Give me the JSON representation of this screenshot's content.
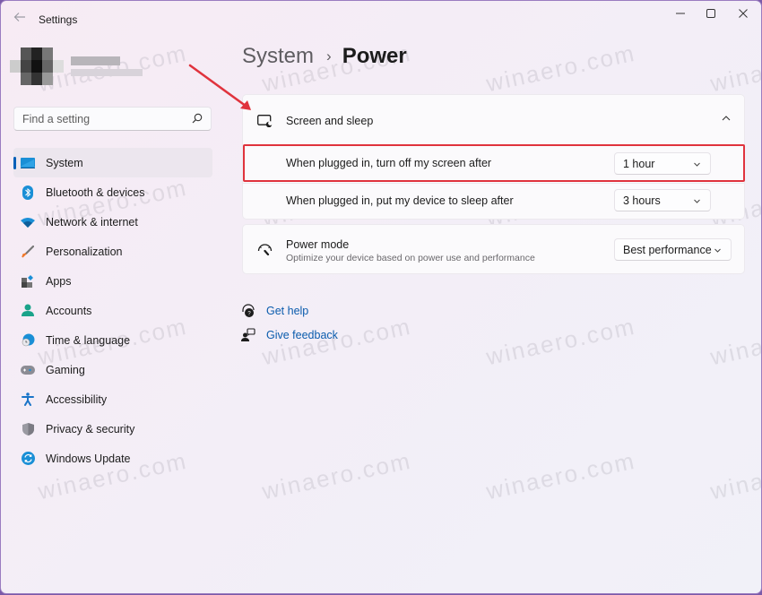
{
  "window": {
    "title": "Settings",
    "controls": [
      "minimize",
      "maximize",
      "close"
    ]
  },
  "search": {
    "placeholder": "Find a setting"
  },
  "sidebar": {
    "items": [
      {
        "label": "System",
        "icon": "monitor-icon",
        "active": true
      },
      {
        "label": "Bluetooth & devices",
        "icon": "bluetooth-icon"
      },
      {
        "label": "Network & internet",
        "icon": "wifi-icon"
      },
      {
        "label": "Personalization",
        "icon": "brush-icon"
      },
      {
        "label": "Apps",
        "icon": "apps-icon"
      },
      {
        "label": "Accounts",
        "icon": "person-icon"
      },
      {
        "label": "Time & language",
        "icon": "globe-clock-icon"
      },
      {
        "label": "Gaming",
        "icon": "gamepad-icon"
      },
      {
        "label": "Accessibility",
        "icon": "accessibility-icon"
      },
      {
        "label": "Privacy & security",
        "icon": "shield-icon"
      },
      {
        "label": "Windows Update",
        "icon": "update-icon"
      }
    ]
  },
  "breadcrumb": {
    "parent": "System",
    "separator": "›",
    "current": "Power"
  },
  "screen_sleep": {
    "title": "Screen and sleep",
    "expanded": true,
    "rows": [
      {
        "label": "When plugged in, turn off my screen after",
        "value": "1 hour"
      },
      {
        "label": "When plugged in, put my device to sleep after",
        "value": "3 hours"
      }
    ]
  },
  "power_mode": {
    "title": "Power mode",
    "description": "Optimize your device based on power use and performance",
    "value": "Best performance"
  },
  "links": [
    {
      "label": "Get help",
      "icon": "help-icon"
    },
    {
      "label": "Give feedback",
      "icon": "feedback-icon"
    }
  ],
  "watermark": "winaero.com",
  "colors": {
    "accent": "#005fb8",
    "highlight": "#e0333d",
    "link": "#0b5cad"
  }
}
